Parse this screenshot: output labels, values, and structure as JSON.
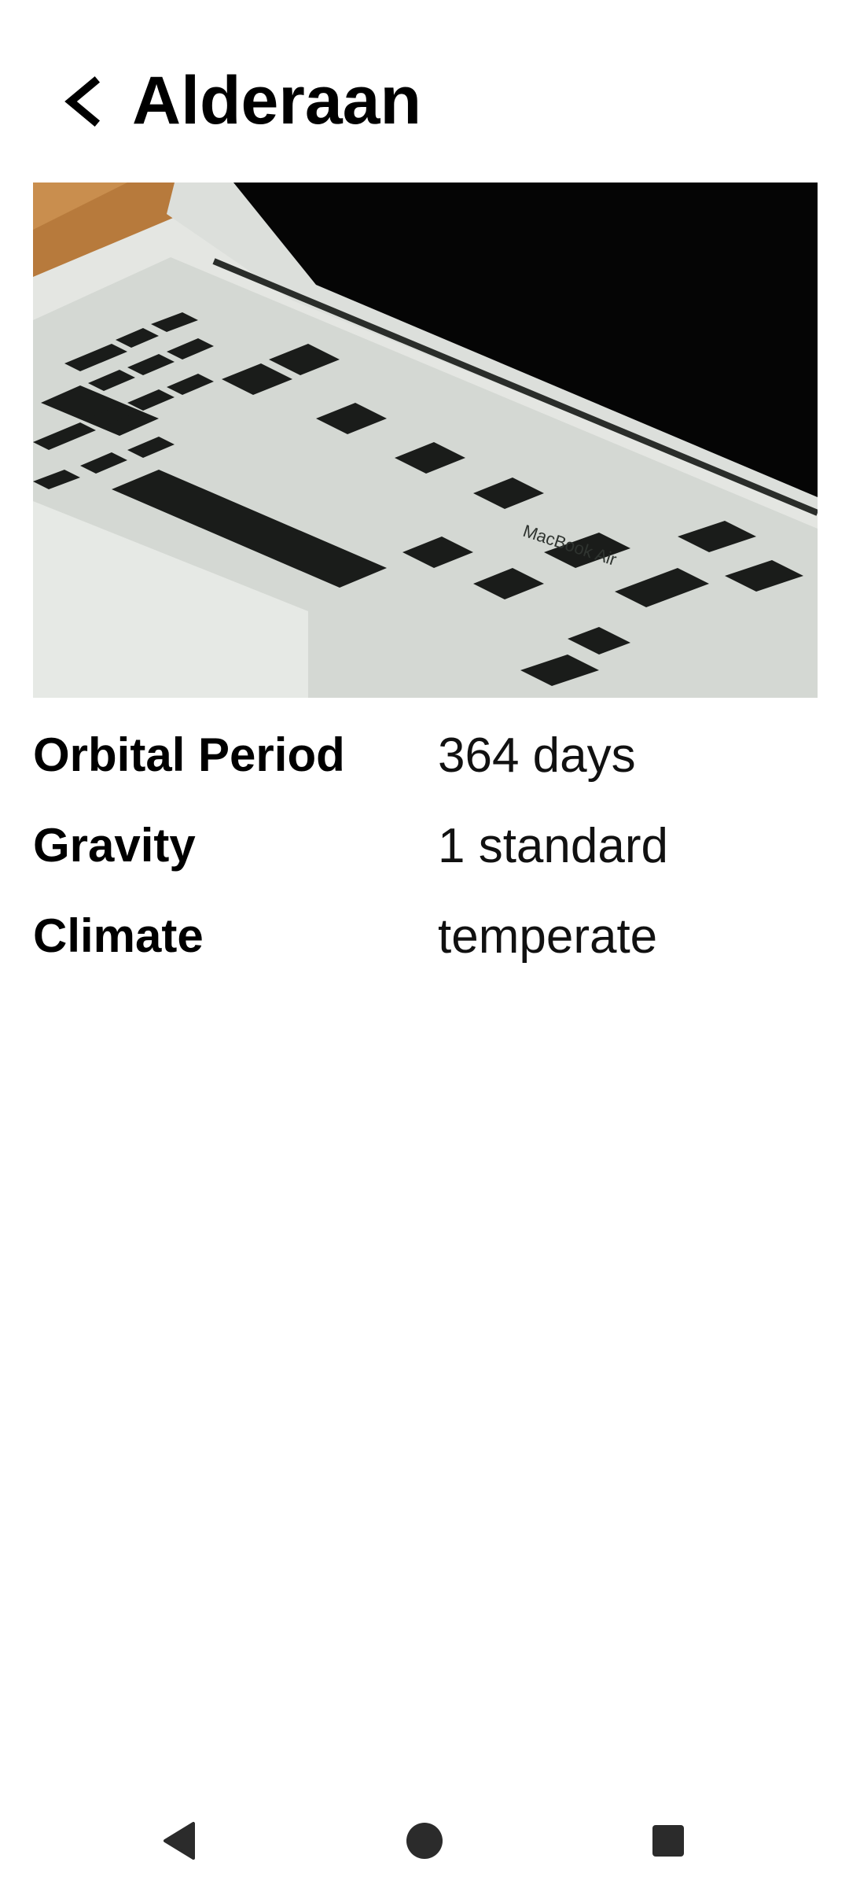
{
  "header": {
    "title": "Alderaan",
    "back_icon": "chevron-left-icon"
  },
  "hero": {
    "brand_text": "MacBook Air"
  },
  "properties": [
    {
      "label": "Orbital Period",
      "value": "364 days"
    },
    {
      "label": "Gravity",
      "value": "1 standard"
    },
    {
      "label": "Climate",
      "value": "temperate"
    }
  ],
  "navigation": {
    "back_icon": "triangle-back-icon",
    "home_icon": "circle-home-icon",
    "recents_icon": "square-recents-icon"
  },
  "colors": {
    "background": "#ffffff",
    "text": "#000000",
    "nav_icon": "#2b2b2b"
  }
}
